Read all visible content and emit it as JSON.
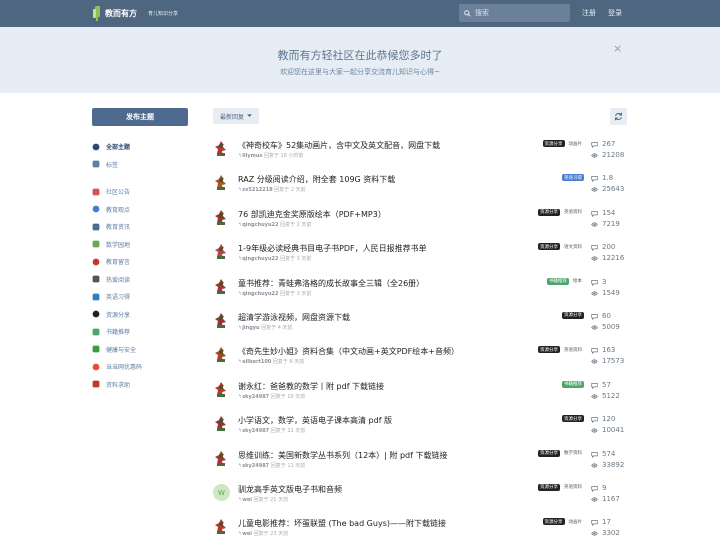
{
  "header": {
    "logo_title": "教而有方",
    "logo_sub": "育儿知识分享",
    "search_placeholder": "搜索",
    "register": "注册",
    "login": "登录"
  },
  "hero": {
    "title": "教而有方轻社区在此恭候您多时了",
    "subtitle": "欢迎您在这里与大家一起分享交流育儿知识与心得~",
    "close": "×"
  },
  "sidebar": {
    "compose": "发布主题",
    "items": [
      {
        "label": "全部主题",
        "color": "#2c4a6e"
      },
      {
        "label": "标签",
        "color": "#5d7fa6"
      },
      {
        "label": "社区公告",
        "color": "#d9534f"
      },
      {
        "label": "教育观点",
        "color": "#4a7bd1"
      },
      {
        "label": "教育资讯",
        "color": "#4e6b8f"
      },
      {
        "label": "数学园地",
        "color": "#6aa84f"
      },
      {
        "label": "教育留言",
        "color": "#c0392b"
      },
      {
        "label": "热爱阅读",
        "color": "#555555"
      },
      {
        "label": "英语习得",
        "color": "#2f7fc1"
      },
      {
        "label": "资源分享",
        "color": "#222222"
      },
      {
        "label": "书籍推荐",
        "color": "#4da56a"
      },
      {
        "label": "健康与安全",
        "color": "#3d9b3d"
      },
      {
        "label": "当当网优惠码",
        "color": "#e74c3c"
      },
      {
        "label": "资料求助",
        "color": "#c0392b"
      }
    ]
  },
  "toolbar": {
    "sort": "最新回复"
  },
  "topics": [
    {
      "title": "《神奇校车》52集动画片，含中文及英文配音，网盘下载",
      "user": "lilymus",
      "time": "回复于 16 小时前",
      "tags": [
        {
          "t": "资源分享",
          "c": "dark"
        },
        {
          "t": "动画片",
          "c": "lite"
        }
      ],
      "replies": "267",
      "views": "21208"
    },
    {
      "title": "RAZ 分级阅读介绍，附全套 109G 资料下载",
      "user": "zx5212218",
      "time": "回复于 2 天前",
      "tags": [
        {
          "t": "英语习得",
          "c": "blue"
        }
      ],
      "replies": "1.8",
      "views": "25643"
    },
    {
      "title": "76 部凯迪克金奖原版绘本（PDF+MP3）",
      "user": "qingchuyu22",
      "time": "回复于 2 天前",
      "tags": [
        {
          "t": "资源分享",
          "c": "dark"
        },
        {
          "t": "英语资料",
          "c": "lite"
        }
      ],
      "replies": "154",
      "views": "7219"
    },
    {
      "title": "1-9年级必读经典书目电子书PDF，人民日报推荐书单",
      "user": "qingchuyu22",
      "time": "回复于 3 天前",
      "tags": [
        {
          "t": "资源分享",
          "c": "dark"
        },
        {
          "t": "语文资料",
          "c": "lite"
        }
      ],
      "replies": "200",
      "views": "12216"
    },
    {
      "title": "童书推荐：青蛙弗洛格的成长故事全三辑（全26册）",
      "user": "qingchuyu22",
      "time": "回复于 3 天前",
      "tags": [
        {
          "t": "书籍推荐",
          "c": "green"
        },
        {
          "t": "绘本",
          "c": "lite"
        }
      ],
      "replies": "3",
      "views": "1549"
    },
    {
      "title": "超清学游泳视频，网盘资源下载",
      "user": "jingyu",
      "time": "回复于 4 天前",
      "tags": [
        {
          "t": "资源分享",
          "c": "dark"
        }
      ],
      "replies": "60",
      "views": "5009"
    },
    {
      "title": "《奇先生妙小姐》资料合集（中文动画+英文PDF绘本+音频）",
      "user": "eilbert100",
      "time": "回复于 6 天前",
      "tags": [
        {
          "t": "资源分享",
          "c": "dark"
        },
        {
          "t": "英语资料",
          "c": "lite"
        }
      ],
      "replies": "163",
      "views": "17573"
    },
    {
      "title": "谢永红：爸爸教的数学丨附 pdf 下载链接",
      "user": "sky24987",
      "time": "回复于 10 天前",
      "tags": [
        {
          "t": "书籍推荐",
          "c": "green"
        }
      ],
      "replies": "57",
      "views": "5122"
    },
    {
      "title": "小学语文，数学，英语电子课本高清 pdf 版",
      "user": "sky24987",
      "time": "回复于 11 天前",
      "tags": [
        {
          "t": "资源分享",
          "c": "dark"
        }
      ],
      "replies": "120",
      "views": "10041"
    },
    {
      "title": "思维训练：美国新数学丛书系列（12本）| 附 pdf 下载链接",
      "user": "sky24987",
      "time": "回复于 11 天前",
      "tags": [
        {
          "t": "资源分享",
          "c": "dark"
        },
        {
          "t": "数学资料",
          "c": "lite"
        }
      ],
      "replies": "574",
      "views": "33892"
    },
    {
      "title": "驯龙高手英文版电子书和音频",
      "user": "wei",
      "time": "回复于 21 天前",
      "tags": [
        {
          "t": "资源分享",
          "c": "dark"
        },
        {
          "t": "英语资料",
          "c": "lite"
        }
      ],
      "replies": "9",
      "views": "1167"
    },
    {
      "title": "儿童电影推荐：坏蛋联盟 (The bad Guys)——附下载链接",
      "user": "wei",
      "time": "回复于 23 天前",
      "tags": [
        {
          "t": "资源分享",
          "c": "dark"
        },
        {
          "t": "动画片",
          "c": "lite"
        }
      ],
      "replies": "17",
      "views": "3302"
    }
  ]
}
